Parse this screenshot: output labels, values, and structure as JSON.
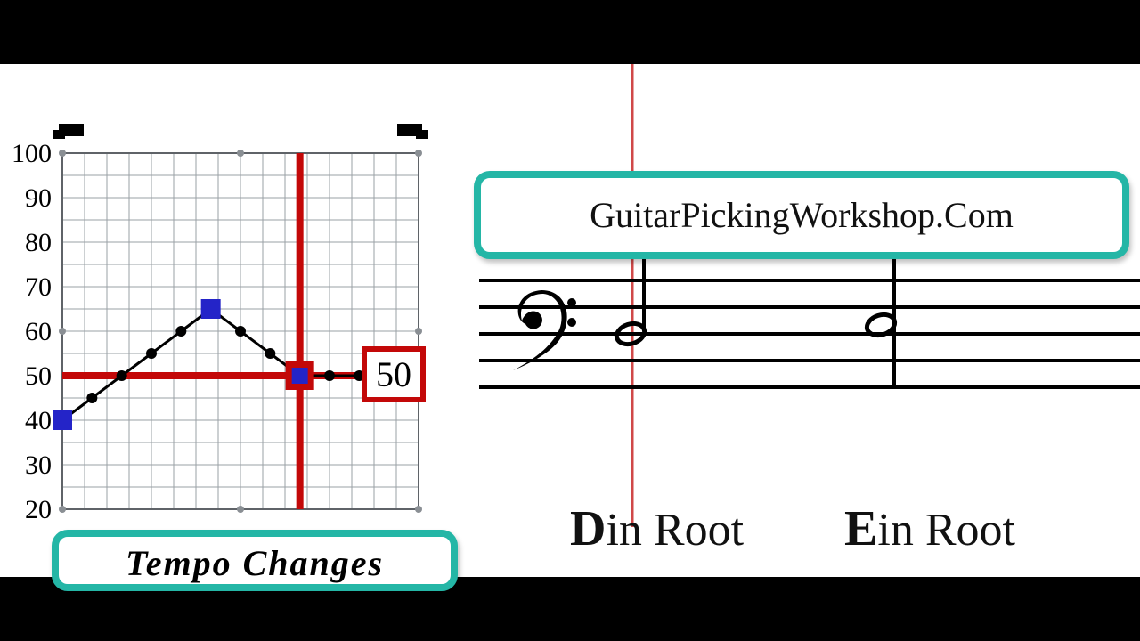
{
  "chart_data": {
    "type": "line",
    "title": "Tempo Changes",
    "xlabel": "",
    "ylabel": "",
    "ylim": [
      20,
      100
    ],
    "yticks": [
      20,
      30,
      40,
      50,
      60,
      70,
      80,
      90,
      100
    ],
    "x": [
      0,
      1,
      2,
      3,
      4,
      5,
      6,
      7,
      8,
      9,
      10,
      11,
      12
    ],
    "values": [
      40,
      45,
      50,
      55,
      60,
      65,
      60,
      55,
      50,
      50,
      50,
      50,
      50
    ],
    "crosshair": {
      "x": 8,
      "y": 50
    },
    "highlight_squares": [
      {
        "x": 0,
        "y": 40
      },
      {
        "x": 5,
        "y": 65
      },
      {
        "x": 8,
        "y": 50
      }
    ],
    "readout": "50"
  },
  "panel": {
    "chart_title": "Tempo  Changes",
    "readout": "50"
  },
  "right": {
    "site_label": "GuitarPickingWorkshop.Com",
    "chords": [
      {
        "note": "D",
        "suffix": " in Root"
      },
      {
        "note": "E",
        "suffix": " in Root"
      }
    ]
  },
  "colors": {
    "accent": "#24b6a6",
    "cross": "#c30808",
    "square": "#2424c8"
  }
}
